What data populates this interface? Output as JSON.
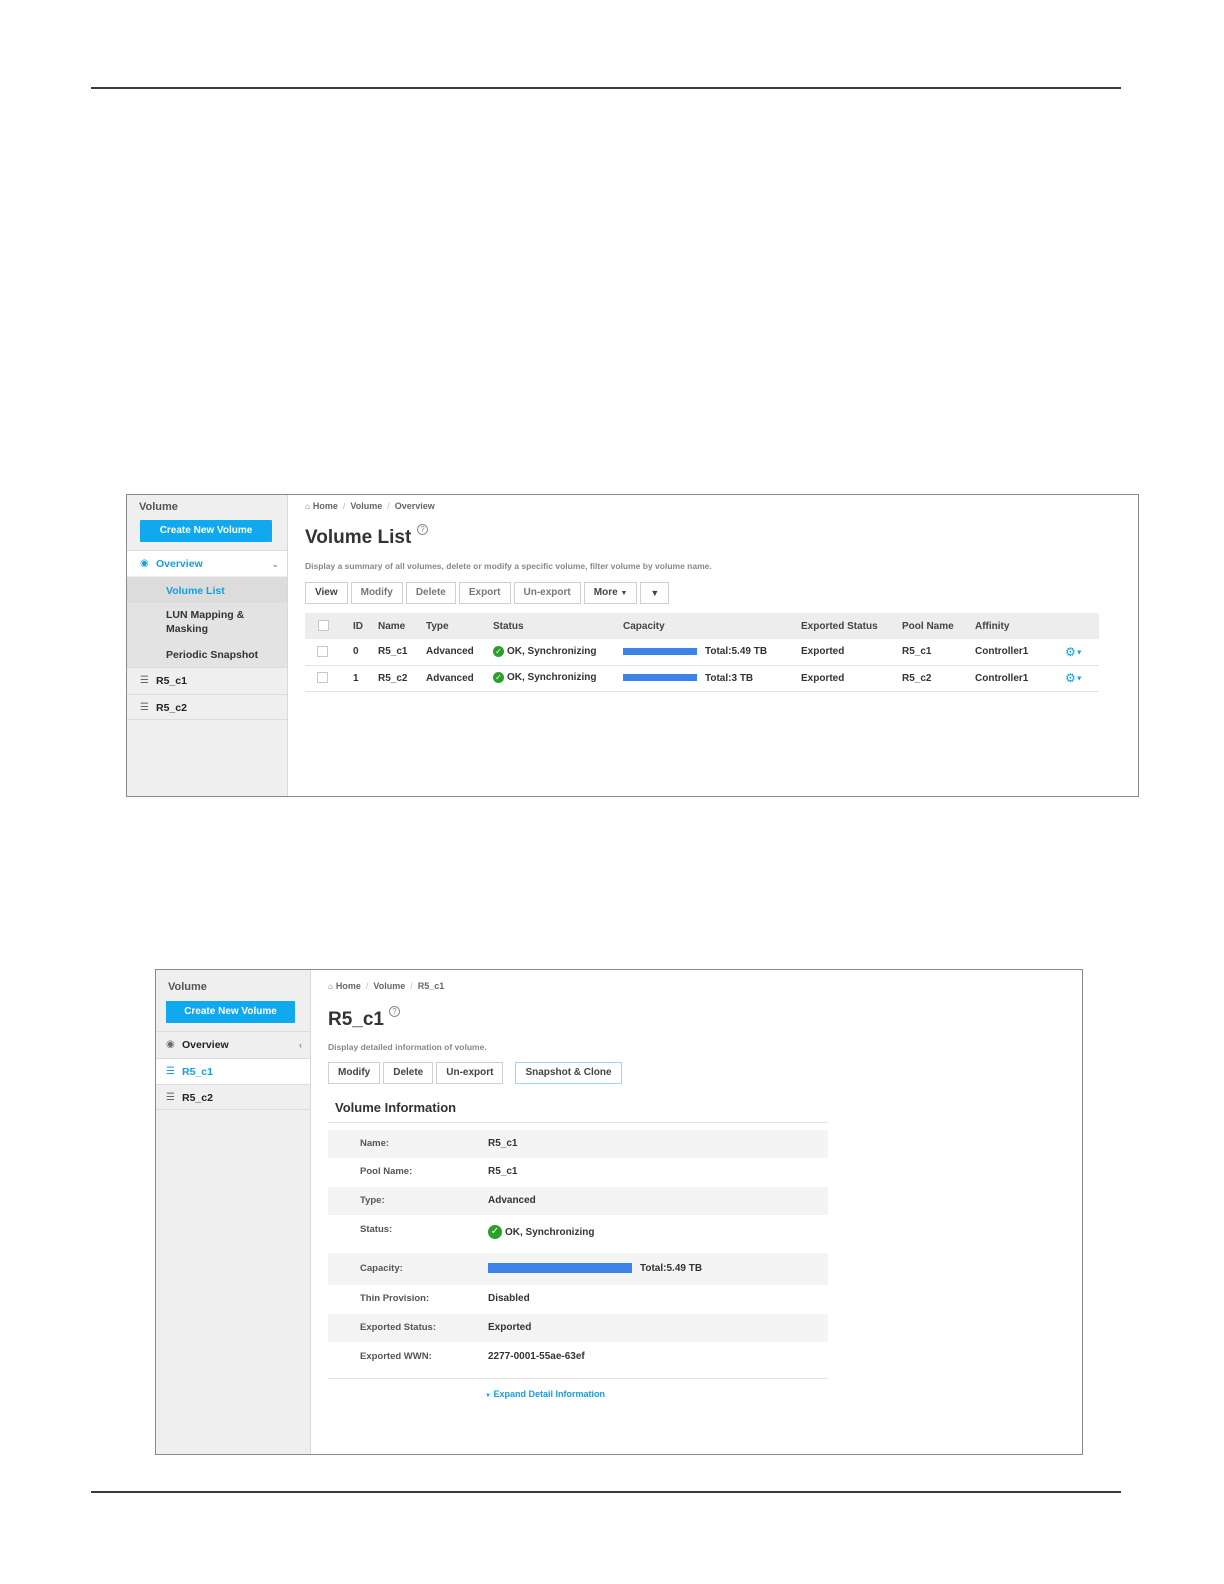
{
  "common": {
    "sidebar_title": "Volume",
    "create_button": "Create New Volume",
    "home_icon": "home-icon",
    "ok_icon": "check-circle-icon",
    "accent_color": "#10a8ef",
    "capacity_color": "#3c82e8",
    "ok_color": "#2aa02a"
  },
  "shot1": {
    "breadcrumb": [
      "Home",
      "Volume",
      "Overview"
    ],
    "sidebar": {
      "overview": "Overview",
      "sub_items": [
        "Volume List",
        "LUN Mapping &",
        "Masking",
        "Periodic Snapshot"
      ],
      "volumes": [
        "R5_c1",
        "R5_c2"
      ]
    },
    "title": "Volume List",
    "description": "Display a summary of all volumes, delete or modify a specific volume, filter volume by volume name.",
    "toolbar": {
      "view": "View",
      "modify": "Modify",
      "delete": "Delete",
      "export": "Export",
      "unexport": "Un-export",
      "more": "More",
      "filter_icon": "filter-icon"
    },
    "table": {
      "headers": [
        "ID",
        "Name",
        "Type",
        "Status",
        "Capacity",
        "Exported Status",
        "Pool Name",
        "Affinity"
      ],
      "rows": [
        {
          "id": "0",
          "name": "R5_c1",
          "type": "Advanced",
          "status": "OK, Synchronizing",
          "capacity": "Total:5.49 TB",
          "exported": "Exported",
          "pool": "R5_c1",
          "affinity": "Controller1"
        },
        {
          "id": "1",
          "name": "R5_c2",
          "type": "Advanced",
          "status": "OK, Synchronizing",
          "capacity": "Total:3 TB",
          "exported": "Exported",
          "pool": "R5_c2",
          "affinity": "Controller1"
        }
      ]
    }
  },
  "shot2": {
    "breadcrumb": [
      "Home",
      "Volume",
      "R5_c1"
    ],
    "sidebar": {
      "overview": "Overview",
      "volumes": [
        "R5_c1",
        "R5_c2"
      ]
    },
    "title": "R5_c1",
    "description": "Display detailed information of volume.",
    "toolbar": {
      "modify": "Modify",
      "delete": "Delete",
      "unexport": "Un-export",
      "snapshot": "Snapshot & Clone"
    },
    "section_title": "Volume Information",
    "info": {
      "name_k": "Name:",
      "name_v": "R5_c1",
      "pool_k": "Pool Name:",
      "pool_v": "R5_c1",
      "type_k": "Type:",
      "type_v": "Advanced",
      "status_k": "Status:",
      "status_v": "OK, Synchronizing",
      "capacity_k": "Capacity:",
      "capacity_v": "Total:5.49 TB",
      "thin_k": "Thin Provision:",
      "thin_v": "Disabled",
      "exported_k": "Exported Status:",
      "exported_v": "Exported",
      "wwn_k": "Exported WWN:",
      "wwn_v": "2277-0001-55ae-63ef"
    },
    "expand": "Expand Detail Information"
  }
}
